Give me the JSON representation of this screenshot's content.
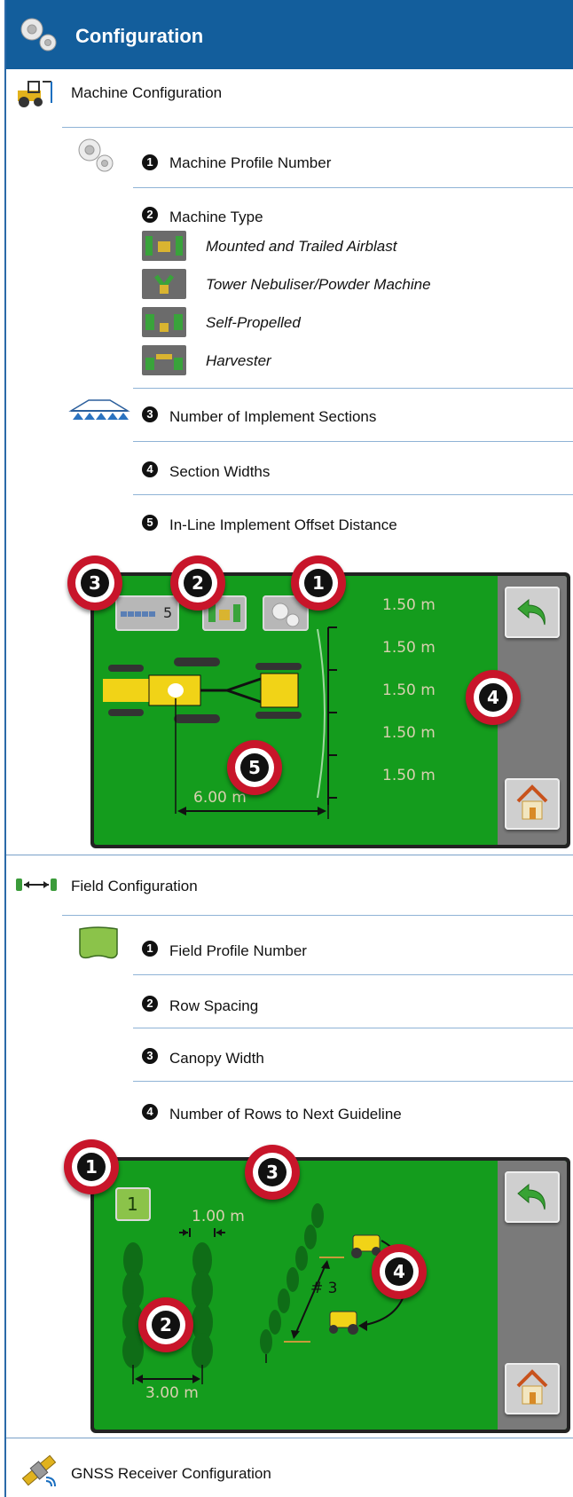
{
  "header": {
    "title": "Configuration"
  },
  "machine": {
    "title": "Machine Configuration",
    "items": [
      {
        "num": "1",
        "label": "Machine Profile Number"
      },
      {
        "num": "2",
        "label": "Machine Type"
      },
      {
        "num": "3",
        "label": "Number of Implement Sections"
      },
      {
        "num": "4",
        "label": "Section Widths"
      },
      {
        "num": "5",
        "label": "In-Line Implement Offset Distance"
      }
    ],
    "types": [
      "Mounted and Trailed Airblast",
      "Tower Nebuliser/Powder Machine",
      "Self-Propelled",
      "Harvester"
    ],
    "screen": {
      "sections_count": "5",
      "widths": [
        "1.50 m",
        "1.50 m",
        "1.50 m",
        "1.50 m",
        "1.50 m"
      ],
      "offset": "6.00 m",
      "callouts": [
        "3",
        "2",
        "1",
        "4",
        "5"
      ]
    }
  },
  "field": {
    "title": "Field Configuration",
    "items": [
      {
        "num": "1",
        "label": "Field Profile Number"
      },
      {
        "num": "2",
        "label": "Row Spacing"
      },
      {
        "num": "3",
        "label": "Canopy Width"
      },
      {
        "num": "4",
        "label": "Number of Rows to Next Guideline"
      }
    ],
    "screen": {
      "profile": "1",
      "canopy": "1.00 m",
      "spacing": "3.00 m",
      "rows": "# 3",
      "callouts": [
        "1",
        "3",
        "2",
        "4"
      ]
    }
  },
  "gnss": {
    "title": "GNSS Receiver Configuration"
  },
  "colors": {
    "header": "#135e9c",
    "screen_green": "#149c1d",
    "callout_red": "#c8152a"
  }
}
